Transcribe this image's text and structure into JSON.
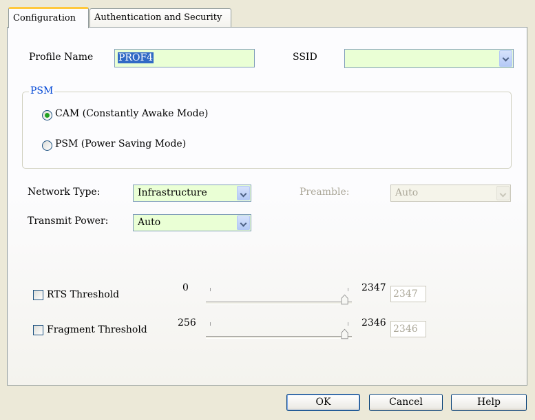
{
  "tabs": [
    {
      "label": "Configuration",
      "active": true
    },
    {
      "label": "Authentication and Security",
      "active": false
    }
  ],
  "profile": {
    "profile_name_label": "Profile Name",
    "profile_name_value": "PROF4",
    "ssid_label": "SSID",
    "ssid_value": ""
  },
  "psm": {
    "group_label": "PSM",
    "options": [
      {
        "label": "CAM (Constantly Awake Mode)",
        "selected": true
      },
      {
        "label": "PSM (Power Saving Mode)",
        "selected": false
      }
    ]
  },
  "network": {
    "network_type_label": "Network Type:",
    "network_type_value": "Infrastructure",
    "preamble_label": "Preamble:",
    "preamble_value": "Auto",
    "transmit_power_label": "Transmit Power:",
    "transmit_power_value": "Auto"
  },
  "rts": {
    "label": "RTS Threshold",
    "checked": false,
    "min": "0",
    "max": "2347",
    "value": "2347"
  },
  "fragment": {
    "label": "Fragment Threshold",
    "checked": false,
    "min": "256",
    "max": "2346",
    "value": "2346"
  },
  "buttons": {
    "ok": "OK",
    "cancel": "Cancel",
    "help": "Help"
  },
  "colors": {
    "field_bg": "#eaffd5",
    "active_tab_accent": "#ffc83c",
    "group_legend": "#0046d5"
  }
}
